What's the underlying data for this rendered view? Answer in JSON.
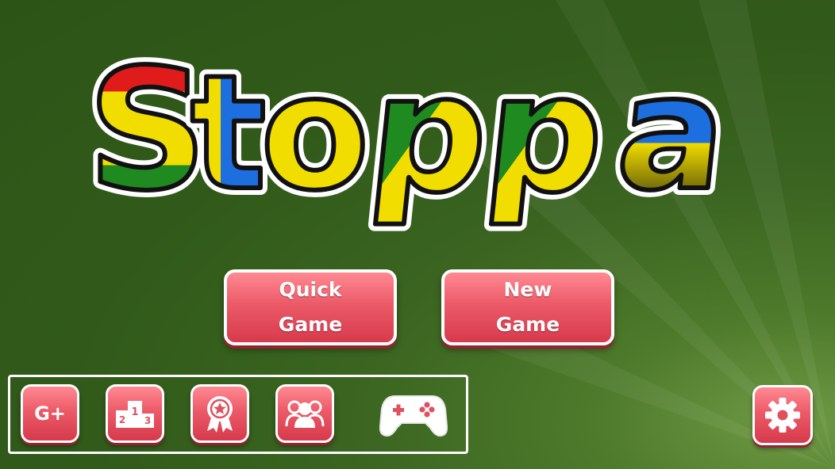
{
  "app": {
    "title": "Stoppa"
  },
  "menu": {
    "quick_game": [
      "Quick",
      "Game"
    ],
    "new_game": [
      "New",
      "Game"
    ]
  },
  "toolbar": {
    "google_plus_label": "G+",
    "leaderboard_digits": [
      "1",
      "2",
      "3"
    ]
  },
  "icons": [
    "google-plus-icon",
    "leaderboard-icon",
    "achievement-icon",
    "multiplayer-icon",
    "gamepad-icon",
    "gear-icon"
  ],
  "colors": {
    "background": "#3a6420",
    "button": "#ec5a68",
    "button_border": "#ffffff"
  }
}
